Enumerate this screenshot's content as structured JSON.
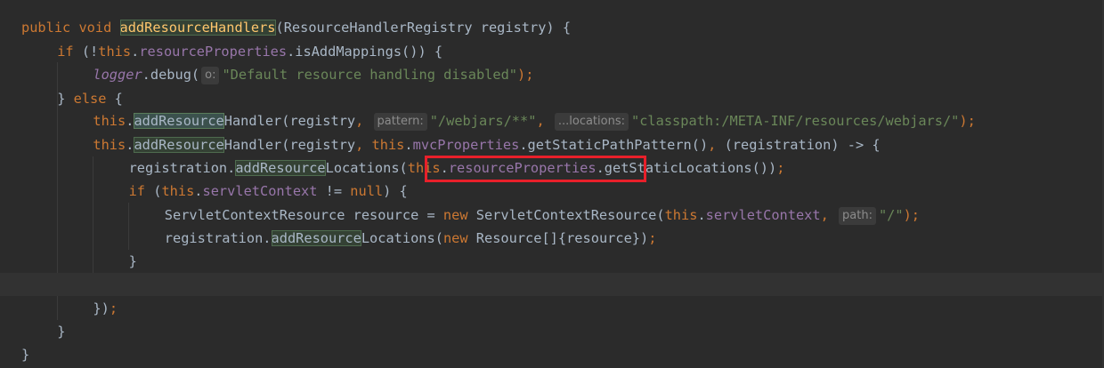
{
  "editor": {
    "lines": [
      {
        "segments": [
          {
            "text": "public void ",
            "cls": "kw"
          },
          {
            "text": "addResourceHandlers",
            "cls": "mth hl"
          },
          {
            "text": "(ResourceHandlerRegistry registry) {",
            "cls": "def"
          }
        ]
      },
      {
        "segments": [
          {
            "text": "if ",
            "cls": "kw"
          },
          {
            "text": "(!",
            "cls": "def"
          },
          {
            "text": "this",
            "cls": "kw"
          },
          {
            "text": ".",
            "cls": "def"
          },
          {
            "text": "resourceProperties",
            "cls": "fld"
          },
          {
            "text": ".isAddMappings()) {",
            "cls": "def"
          }
        ]
      },
      {
        "segments": [
          {
            "text": "logger",
            "cls": "fld-it"
          },
          {
            "text": ".debug(",
            "cls": "def"
          },
          {
            "hint": "o:"
          },
          {
            "text": "\"Default resource handling disabled\"",
            "cls": "str"
          },
          {
            "text": ");",
            "cls": "kw"
          }
        ]
      },
      {
        "segments": [
          {
            "text": "} ",
            "cls": "def"
          },
          {
            "text": "else ",
            "cls": "kw"
          },
          {
            "text": "{",
            "cls": "def"
          }
        ]
      },
      {
        "segments": [
          {
            "text": "this",
            "cls": "kw"
          },
          {
            "text": ".",
            "cls": "def"
          },
          {
            "text": "addResource",
            "cls": "def hl-strong"
          },
          {
            "text": "Handler(registry",
            "cls": "def"
          },
          {
            "text": ", ",
            "cls": "kw"
          },
          {
            "hint": "pattern:"
          },
          {
            "text": "\"/webjars/**\"",
            "cls": "str"
          },
          {
            "text": ", ",
            "cls": "kw"
          },
          {
            "hint": "...locations:"
          },
          {
            "text": "\"classpath:/META-INF/resources/webjars/\"",
            "cls": "str"
          },
          {
            "text": ");",
            "cls": "kw"
          }
        ]
      },
      {
        "segments": [
          {
            "text": "this",
            "cls": "kw"
          },
          {
            "text": ".",
            "cls": "def"
          },
          {
            "text": "addResource",
            "cls": "def hl"
          },
          {
            "text": "Handler(registry",
            "cls": "def"
          },
          {
            "text": ", ",
            "cls": "kw"
          },
          {
            "text": "this",
            "cls": "kw"
          },
          {
            "text": ".",
            "cls": "def"
          },
          {
            "text": "mvcProperties",
            "cls": "fld"
          },
          {
            "text": ".getStaticPathPattern()",
            "cls": "def"
          },
          {
            "text": ", ",
            "cls": "kw"
          },
          {
            "text": "(registration) -> {",
            "cls": "def"
          }
        ]
      },
      {
        "segments": [
          {
            "text": "registration.",
            "cls": "def"
          },
          {
            "text": "addResource",
            "cls": "def hl"
          },
          {
            "text": "Locations(",
            "cls": "def"
          },
          {
            "text": "this",
            "cls": "kw"
          },
          {
            "text": ".",
            "cls": "def"
          },
          {
            "text": "resourceProperties",
            "cls": "fld"
          },
          {
            "text": ".getStaticLocations())",
            "cls": "def"
          },
          {
            "text": ";",
            "cls": "kw"
          }
        ]
      },
      {
        "segments": [
          {
            "text": "if ",
            "cls": "kw"
          },
          {
            "text": "(",
            "cls": "def"
          },
          {
            "text": "this",
            "cls": "kw"
          },
          {
            "text": ".",
            "cls": "def"
          },
          {
            "text": "servletContext",
            "cls": "fld"
          },
          {
            "text": " != ",
            "cls": "def"
          },
          {
            "text": "null",
            "cls": "kw"
          },
          {
            "text": ") {",
            "cls": "def"
          }
        ]
      },
      {
        "segments": [
          {
            "text": "ServletContextResource resource = ",
            "cls": "def"
          },
          {
            "text": "new ",
            "cls": "kw"
          },
          {
            "text": "ServletContextResource(",
            "cls": "def"
          },
          {
            "text": "this",
            "cls": "kw"
          },
          {
            "text": ".",
            "cls": "def"
          },
          {
            "text": "servletContext",
            "cls": "fld"
          },
          {
            "text": ", ",
            "cls": "kw"
          },
          {
            "hint": "path:"
          },
          {
            "text": "\"/\"",
            "cls": "str"
          },
          {
            "text": ");",
            "cls": "kw"
          }
        ]
      },
      {
        "segments": [
          {
            "text": "registration.",
            "cls": "def"
          },
          {
            "text": "addResource",
            "cls": "def hl"
          },
          {
            "text": "Locations(",
            "cls": "def"
          },
          {
            "text": "new ",
            "cls": "kw"
          },
          {
            "text": "Resource[]{resource})",
            "cls": "def"
          },
          {
            "text": ";",
            "cls": "kw"
          }
        ]
      },
      {
        "segments": [
          {
            "text": "}",
            "cls": "def"
          }
        ]
      },
      {
        "segments": []
      },
      {
        "segments": [
          {
            "text": "})",
            "cls": "def"
          },
          {
            "text": ";",
            "cls": "kw"
          }
        ]
      },
      {
        "segments": [
          {
            "text": "}",
            "cls": "def"
          }
        ]
      },
      {
        "segments": [
          {
            "text": "}",
            "cls": "def"
          }
        ]
      }
    ]
  },
  "colors": {
    "background": "#2b2b2b",
    "keyword": "#cc7832",
    "field": "#9876aa",
    "string": "#6a8759",
    "method_decl": "#ffc66d",
    "default_text": "#a9b7c6",
    "annotation_box": "#e8202a"
  }
}
